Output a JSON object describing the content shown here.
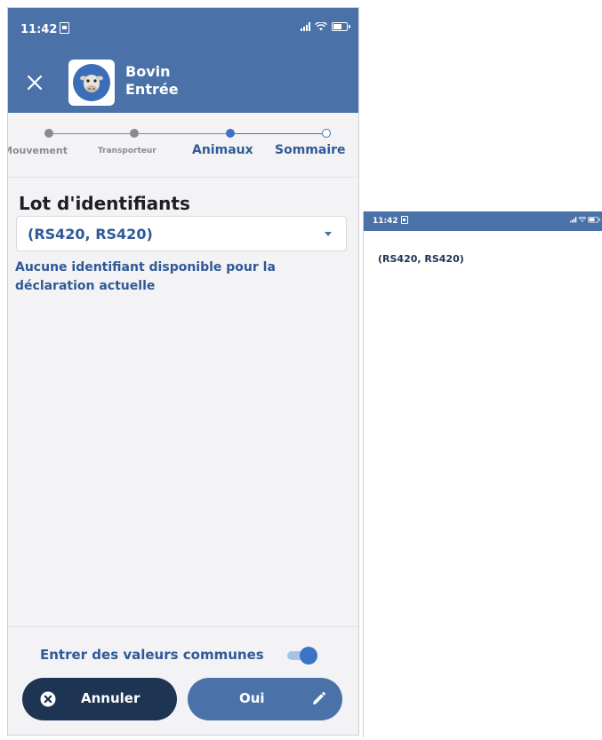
{
  "status_bar": {
    "time": "11:42"
  },
  "header": {
    "title_line1": "Bovin",
    "title_line2": "Entrée"
  },
  "stepper": {
    "steps": [
      {
        "label": "Mouvement",
        "state": "done"
      },
      {
        "label": "Transporteur",
        "state": "done"
      },
      {
        "label": "Animaux",
        "state": "active"
      },
      {
        "label": "Sommaire",
        "state": "pending"
      }
    ]
  },
  "form": {
    "field_label": "Lot d'identifiants",
    "selected_value": "(RS420, RS420)",
    "info_message": "Aucune identifiant disponible pour la déclaration actuelle"
  },
  "footer": {
    "toggle_label": "Entrer des valeurs communes",
    "toggle_on": true,
    "cancel_label": "Annuler",
    "confirm_label": "Oui"
  },
  "picker_screen": {
    "status_time": "11:42",
    "options": [
      "(RS420, RS420)"
    ]
  },
  "colors": {
    "primary": "#4a72a9",
    "dark_button": "#1d3452",
    "text_blue": "#2f5a96",
    "background": "#f3f3f6"
  }
}
